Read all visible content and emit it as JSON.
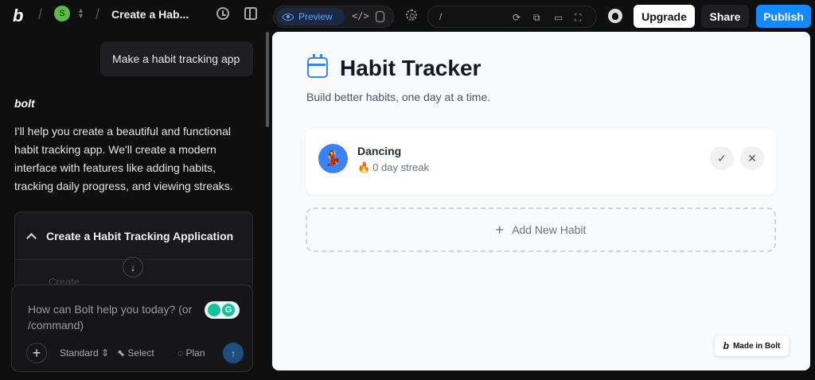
{
  "topbar": {
    "logo": "b",
    "avatar_letter": "S",
    "project_title": "Create a Hab...",
    "view_preview": "Preview",
    "code_label": "</>",
    "url_path": "/",
    "upgrade_label": "Upgrade",
    "share_label": "Share",
    "publish_label": "Publish"
  },
  "chat": {
    "user_message": "Make a habit tracking app",
    "assistant_name": "bolt",
    "assistant_text": "I'll help you create a beautiful and functional habit tracking app. We'll create a modern interface with features like adding habits, tracking daily progress, and viewing streaks.",
    "artifact_title": "Create a Habit Tracking Application",
    "artifact_step_faded": "Create",
    "prompt_placeholder": "How can Bolt help you today? (or /command)",
    "mode_label": "Standard",
    "select_label": "Select",
    "plan_label": "Plan"
  },
  "preview": {
    "title": "Habit Tracker",
    "subtitle": "Build better habits, one day at a time.",
    "habits": [
      {
        "name": "Dancing",
        "streak": "0 day streak",
        "icon": "dancer-emoji"
      }
    ],
    "add_label": "Add New Habit",
    "made_in": "Made in Bolt"
  },
  "colors": {
    "accent": "#3b82f6",
    "publish": "#1488fc",
    "background": "#0f0f10"
  }
}
